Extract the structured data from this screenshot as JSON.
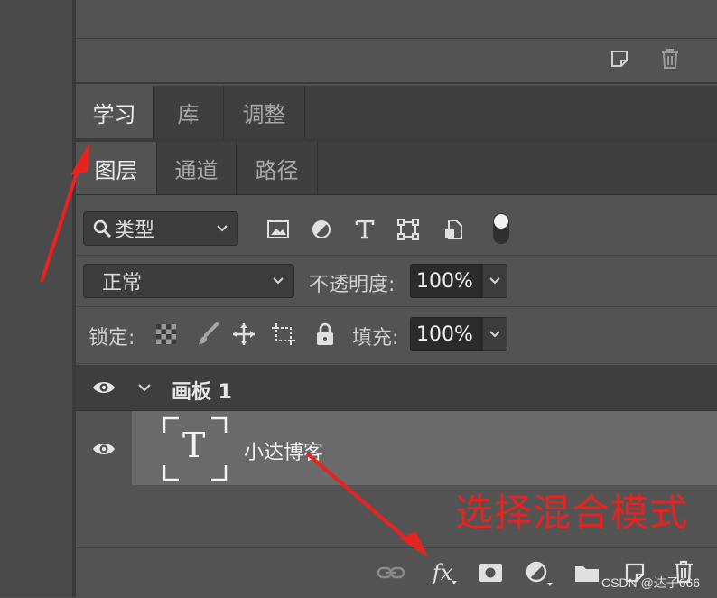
{
  "top_panel": {
    "icons": [
      "new-layer-icon",
      "trash-icon"
    ]
  },
  "tab_group_1": {
    "tabs": [
      {
        "label": "学习",
        "active": true
      },
      {
        "label": "库",
        "active": false
      },
      {
        "label": "调整",
        "active": false
      }
    ]
  },
  "tab_group_2": {
    "tabs": [
      {
        "label": "图层",
        "active": true
      },
      {
        "label": "通道",
        "active": false
      },
      {
        "label": "路径",
        "active": false
      }
    ]
  },
  "filter_row": {
    "filter_label": "类型",
    "filter_icons": [
      "image-filter-icon",
      "adjustment-filter-icon",
      "type-filter-icon",
      "shape-filter-icon",
      "smart-object-filter-icon"
    ],
    "toggle": "filter-toggle"
  },
  "blend_row": {
    "blend_mode": "正常",
    "opacity_label": "不透明度:",
    "opacity_value": "100%"
  },
  "lock_row": {
    "lock_label": "锁定:",
    "lock_icons": [
      "lock-transparent-icon",
      "lock-pixels-icon",
      "lock-position-icon",
      "lock-artboard-icon",
      "lock-all-icon"
    ],
    "fill_label": "填充:",
    "fill_value": "100%"
  },
  "layers": {
    "group_name": "画板 1",
    "items": [
      {
        "name": "小达博客",
        "type": "text",
        "thumb_glyph": "T"
      }
    ]
  },
  "bottom_bar": {
    "icons": [
      "link-layers-icon",
      "fx-icon",
      "layer-mask-icon",
      "adjustment-layer-icon",
      "new-group-icon",
      "new-layer-icon",
      "trash-icon"
    ],
    "fx_label": "fx"
  },
  "annotation": {
    "text": "选择混合模式",
    "color": "#e8231f"
  },
  "watermark": {
    "text": "CSDN @达子666"
  },
  "colors": {
    "panel_bg": "#535353",
    "tab_bg": "#3f3f3f",
    "selected_layer": "#6a6a6a",
    "annotation_red": "#e8231f"
  }
}
